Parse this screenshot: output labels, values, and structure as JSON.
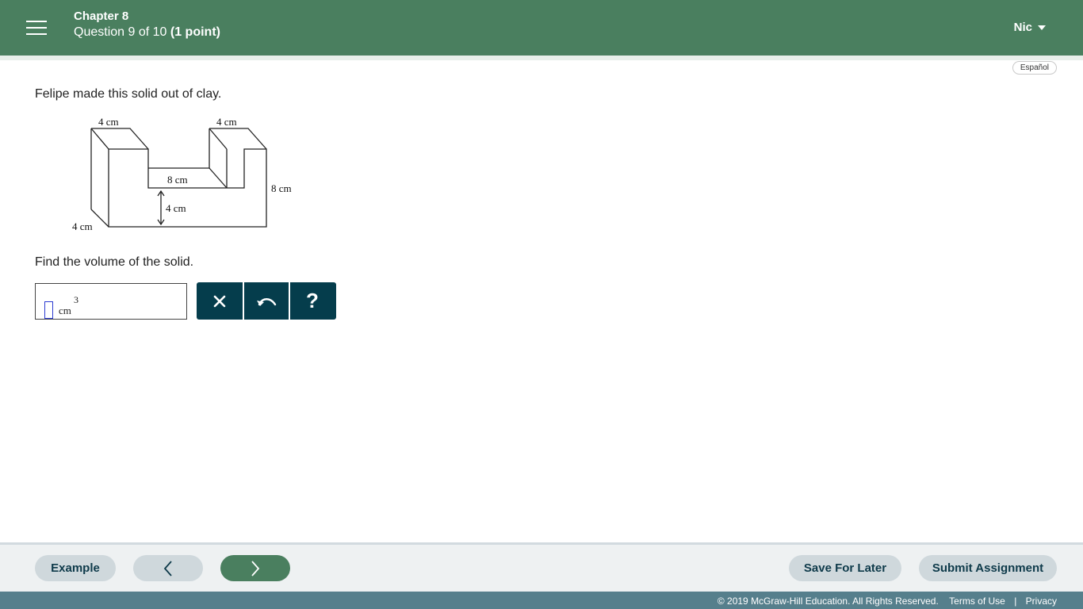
{
  "header": {
    "chapter": "Chapter 8",
    "question_text": "Question 9 of 10",
    "points": "(1 point)",
    "user_name": "Nic"
  },
  "language_toggle": "Español",
  "question": {
    "prompt_1": "Felipe made this solid out of clay.",
    "prompt_2": "Find the volume of the solid.",
    "figure_labels": {
      "top_left": "4 cm",
      "top_right": "4 cm",
      "middle": "8 cm",
      "right": "8 cm",
      "inner_height": "4 cm",
      "depth": "4 cm"
    },
    "answer": {
      "value": "",
      "unit": "cm",
      "unit_exponent": "3"
    }
  },
  "tools": {
    "clear_symbol": "✕",
    "help_symbol": "?"
  },
  "footer": {
    "example_label": "Example",
    "save_label": "Save For Later",
    "submit_label": "Submit Assignment"
  },
  "copyright": {
    "text": "© 2019 McGraw-Hill Education. All Rights Reserved.",
    "terms": "Terms of Use",
    "separator": "|",
    "privacy": "Privacy"
  },
  "colors": {
    "header_bg": "#4a7f5f",
    "tool_bg": "#053d4c",
    "footer_bar_bg": "#567f8c"
  }
}
